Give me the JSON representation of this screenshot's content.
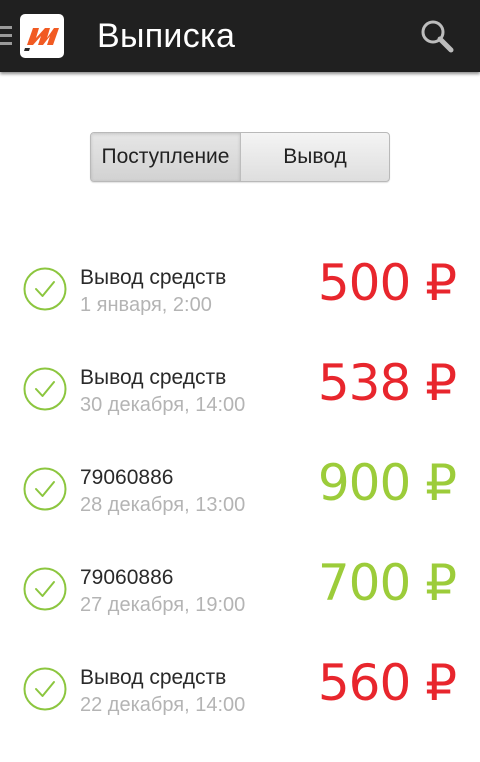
{
  "app": {
    "title": "Выписка"
  },
  "tabs": [
    {
      "label": "Поступление",
      "selected": true
    },
    {
      "label": "Вывод",
      "selected": false
    }
  ],
  "colors": {
    "actionbar": "#202020",
    "accent_green": "#8cc63f",
    "outgoing_red": "#e8262d",
    "incoming_green": "#9ccc3a",
    "logo_orange": "#f15a22"
  },
  "transactions": [
    {
      "title": "Вывод средств",
      "date": "1 января, 2:00",
      "amount": "500 ₽",
      "type": "outgoing",
      "color": "#e8262d"
    },
    {
      "title": "Вывод средств",
      "date": "30 декабря, 14:00",
      "amount": "538 ₽",
      "type": "outgoing",
      "color": "#e8262d"
    },
    {
      "title": "79060886",
      "date": "28 декабря, 13:00",
      "amount": "900 ₽",
      "type": "incoming",
      "color": "#9ccc3a"
    },
    {
      "title": "79060886",
      "date": "27 декабря, 19:00",
      "amount": "700 ₽",
      "type": "incoming",
      "color": "#9ccc3a"
    },
    {
      "title": "Вывод средств",
      "date": "22 декабря, 14:00",
      "amount": "560 ₽",
      "type": "outgoing",
      "color": "#e8262d"
    }
  ],
  "icons": {
    "menu": "hamburger-icon",
    "logo": "app-logo",
    "search": "search-icon",
    "status": "check-circle-icon"
  }
}
